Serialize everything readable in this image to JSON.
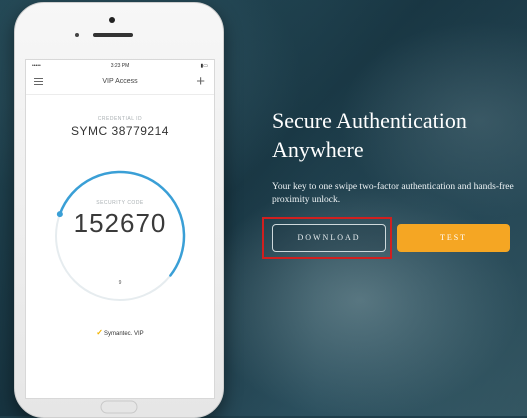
{
  "phone": {
    "status": {
      "carrier": "•••••",
      "time": "3:23 PM",
      "battery": "▮▭"
    },
    "nav": {
      "title": "VIP Access"
    },
    "credential": {
      "label": "CREDENTIAL ID",
      "value": "SYMC 38779214"
    },
    "security": {
      "label": "SECURITY CODE",
      "code": "152670",
      "seconds": "9",
      "timer_fraction": 0.55
    },
    "brand": {
      "check": "✓",
      "name": "Symantec. VIP"
    }
  },
  "hero": {
    "headline_line1": "Secure Authentication",
    "headline_line2": "Anywhere",
    "subtext": "Your key to one swipe two-factor authentication and hands-free proximity unlock.",
    "download_label": "DOWNLOAD",
    "test_label": "TEST"
  },
  "colors": {
    "accent_orange": "#f5a623",
    "timer_blue": "#3a9fd6",
    "highlight_red": "#d11f1f"
  }
}
